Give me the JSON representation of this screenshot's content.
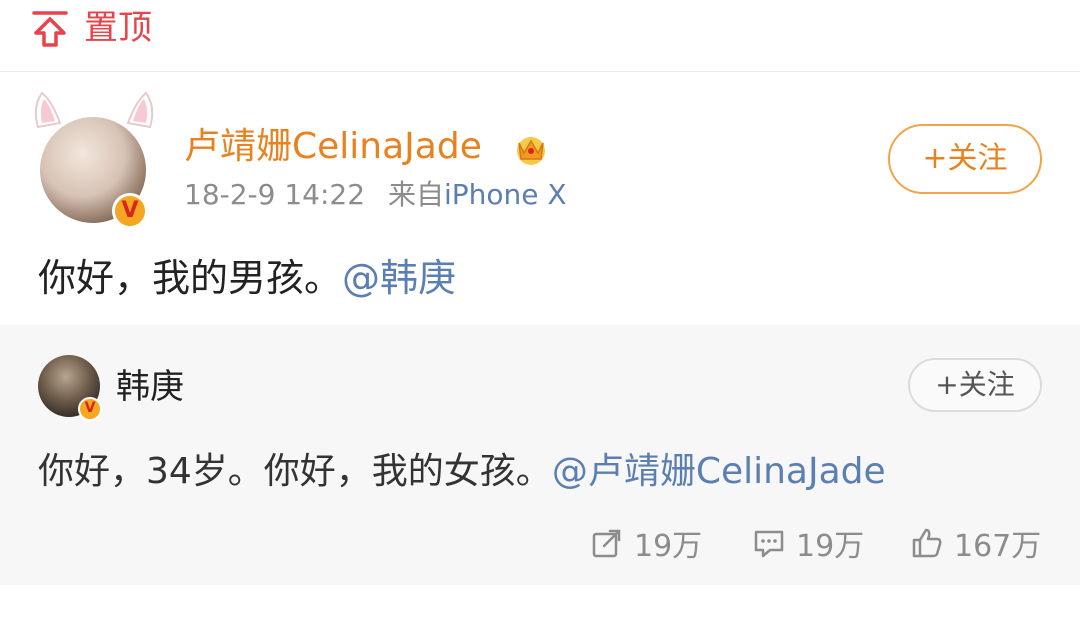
{
  "topbar": {
    "pin_label": "置顶"
  },
  "post": {
    "author": "卢靖姗CelinaJade",
    "timestamp": "18-2-9 14:22",
    "source_prefix": "来自",
    "source": "iPhone X",
    "follow_label": "+关注",
    "text": "你好，我的男孩。",
    "mention": "@韩庚"
  },
  "repost": {
    "author": "韩庚",
    "follow_label": "+关注",
    "text": "你好，34岁。你好，我的女孩。",
    "mention": "@卢靖姗CelinaJade",
    "actions": {
      "repost_count": "19万",
      "comment_count": "19万",
      "like_count": "167万"
    }
  },
  "icons": {
    "pin": "pin-top-icon",
    "crown": "vip-crown-icon",
    "verified": "verified-v-icon",
    "repost": "repost-icon",
    "comment": "comment-icon",
    "like": "like-icon"
  },
  "colors": {
    "accent_red": "#e6444a",
    "name_orange": "#e8821e",
    "link_blue": "#5b7fb0",
    "muted_gray": "#8c8c8c",
    "repost_bg": "#f7f7f7"
  }
}
